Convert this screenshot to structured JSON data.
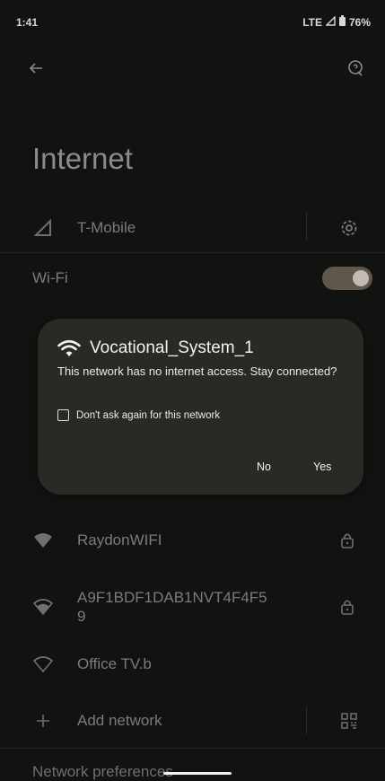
{
  "status": {
    "time": "1:41",
    "network": "LTE",
    "battery": "76%"
  },
  "page": {
    "title": "Internet"
  },
  "mobile": {
    "carrier": "T-Mobile"
  },
  "wifi": {
    "label": "Wi-Fi",
    "enabled": true
  },
  "dialog": {
    "title": "Vocational_System_1",
    "message": "This network has no internet access. Stay connected?",
    "checkbox_label": "Don't ask again for this network",
    "checkbox_checked": false,
    "no_label": "No",
    "yes_label": "Yes"
  },
  "networks": [
    {
      "name": "RaydonWIFI",
      "locked": true
    },
    {
      "name": "A9F1BDF1DAB1NVT4F4F5\n9",
      "locked": true
    },
    {
      "name": "Office TV.b",
      "locked": false
    }
  ],
  "add_network": {
    "label": "Add network"
  },
  "network_preferences": {
    "label": "Network preferences"
  },
  "colors": {
    "background": "#111311",
    "dialog": "#2b2925",
    "switch_track": "#5f564c"
  }
}
